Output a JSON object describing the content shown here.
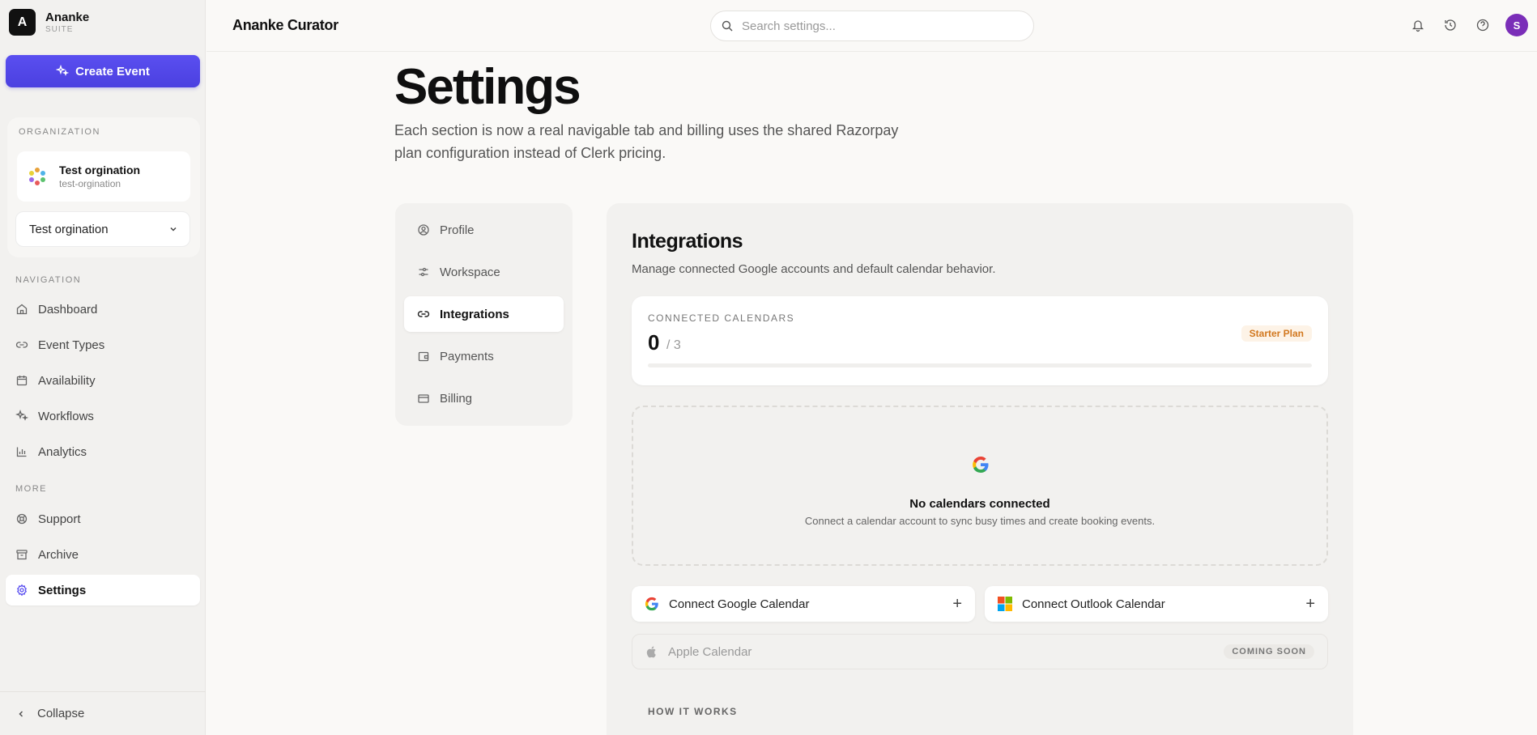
{
  "brand": {
    "logo_letter": "A",
    "name": "Ananke",
    "sub": "SUITE"
  },
  "sidebar": {
    "create_label": "Create Event",
    "org_section": "ORGANIZATION",
    "org_name": "Test orgination",
    "org_slug": "test-orgination",
    "org_select_value": "Test orgination",
    "nav_section": "NAVIGATION",
    "nav": [
      {
        "label": "Dashboard",
        "icon": "home-icon"
      },
      {
        "label": "Event Types",
        "icon": "link-icon"
      },
      {
        "label": "Availability",
        "icon": "calendar-icon"
      },
      {
        "label": "Workflows",
        "icon": "sparkle-icon"
      },
      {
        "label": "Analytics",
        "icon": "bar-chart-icon"
      }
    ],
    "more_section": "MORE",
    "more": [
      {
        "label": "Support",
        "icon": "lifebuoy-icon"
      },
      {
        "label": "Archive",
        "icon": "archive-icon"
      },
      {
        "label": "Settings",
        "icon": "gear-icon",
        "active": true
      }
    ],
    "collapse_label": "Collapse"
  },
  "topbar": {
    "title": "Ananke Curator",
    "search_placeholder": "Search settings...",
    "avatar_letter": "S",
    "avatar_color": "#7a2eb8"
  },
  "page": {
    "title": "Settings",
    "description": "Each section is now a real navigable tab and billing uses the shared Razorpay plan configuration instead of Clerk pricing."
  },
  "tabs": [
    {
      "label": "Profile",
      "icon": "user-circle-icon"
    },
    {
      "label": "Workspace",
      "icon": "sliders-icon"
    },
    {
      "label": "Integrations",
      "icon": "link-icon",
      "active": true
    },
    {
      "label": "Payments",
      "icon": "wallet-icon"
    },
    {
      "label": "Billing",
      "icon": "credit-card-icon"
    }
  ],
  "integrations": {
    "title": "Integrations",
    "description": "Manage connected Google accounts and default calendar behavior.",
    "connected_label": "CONNECTED CALENDARS",
    "connected_count": "0",
    "connected_max": "/ 3",
    "connected_fraction": 0,
    "plan_badge": "Starter Plan",
    "empty_title": "No calendars connected",
    "empty_desc": "Connect a calendar account to sync busy times and create booking events.",
    "google_label": "Connect Google Calendar",
    "outlook_label": "Connect Outlook Calendar",
    "apple_label": "Apple Calendar",
    "apple_badge": "COMING SOON",
    "how_label": "HOW IT WORKS"
  },
  "colors": {
    "accent": "#5a4ff0",
    "plan_badge": "#d2781f"
  }
}
